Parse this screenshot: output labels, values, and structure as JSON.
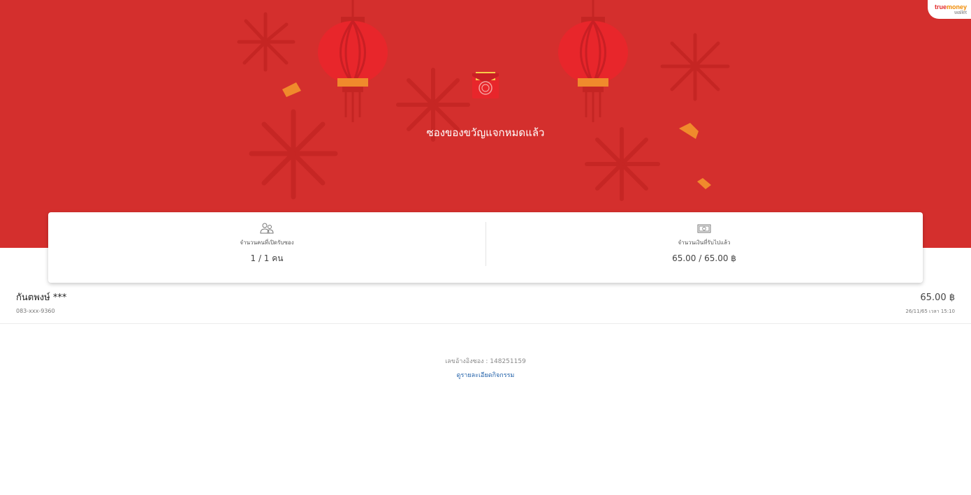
{
  "brand": {
    "name_true": "true",
    "name_money": "money",
    "sub": "wallet"
  },
  "hero": {
    "title": "ซองของขวัญแจกหมดแล้ว"
  },
  "stats": {
    "left": {
      "icon": "people-icon",
      "label": "จำนวนคนที่เปิดรับซอง",
      "value": "1 / 1 คน"
    },
    "right": {
      "icon": "banknote-icon",
      "label": "จำนวนเงินที่รับไปแล้ว",
      "value": "65.00  /  65.00 ฿"
    }
  },
  "recipients": [
    {
      "name": "กันตพงษ์ ***",
      "phone": "083-xxx-9360",
      "amount": "65.00 ฿",
      "time": "26/11/65 เวลา 15:10"
    }
  ],
  "footer": {
    "reference": "เลขอ้างอิงซอง : 148251159",
    "link": "ดูรายละเอียดกิจกรรม"
  },
  "colors": {
    "hero_red": "#d42f2d",
    "lantern_red": "#e8262b",
    "accent_orange": "#f08a2c",
    "link_blue": "#1f5fa8"
  }
}
